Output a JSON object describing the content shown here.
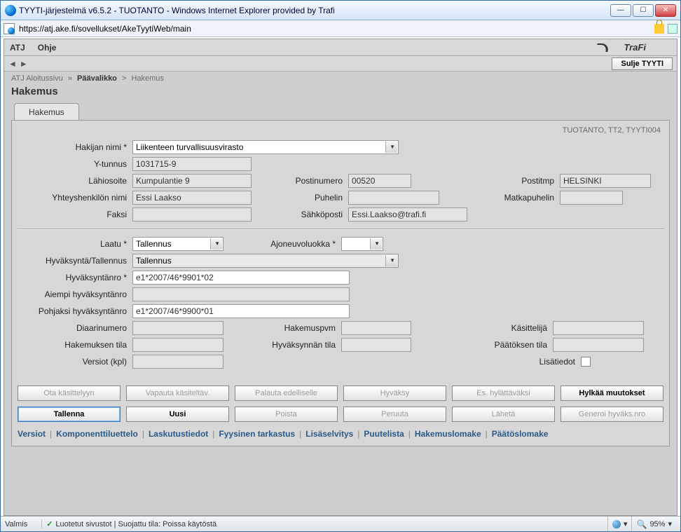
{
  "window": {
    "title": "TYYTI-järjestelmä v6.5.2 - TUOTANTO - Windows Internet Explorer provided by Trafi"
  },
  "addr": {
    "url": "https://atj.ake.fi/sovellukset/AkeTyytiWeb/main"
  },
  "menu": {
    "item1": "ATJ",
    "item2": "Ohje",
    "logo": "TraFi",
    "sulje": "Sulje TYYTI"
  },
  "breadcrumb": {
    "a": "ATJ Aloitussivu",
    "b": "Päävalikko",
    "c": "Hakemus"
  },
  "page": {
    "title": "Hakemus",
    "tab": "Hakemus",
    "env": "TUOTANTO, TT2, TYYTI004"
  },
  "labels": {
    "hakija_nimi": "Hakijan nimi *",
    "ytunnus": "Y-tunnus",
    "lahiosoite": "Lähiosoite",
    "postinumero": "Postinumero",
    "postitmp": "Postitmp",
    "yhteyshenkilo": "Yhteyshenkilön nimi",
    "puhelin": "Puhelin",
    "matkapuhelin": "Matkapuhelin",
    "faksi": "Faksi",
    "sahkoposti": "Sähköposti",
    "laatu": "Laatu *",
    "ajoneuvoluokka": "Ajoneuvoluokka *",
    "hyvtal": "Hyväksyntä/Tallennus",
    "hyvnro": "Hyväksyntänro *",
    "aiempi": "Aiempi hyväksyntänro",
    "pohjaksi": "Pohjaksi hyväksyntänro",
    "diaari": "Diaarinumero",
    "hakemuspvm": "Hakemuspvm",
    "kasittelija": "Käsittelijä",
    "hakemtila": "Hakemuksen tila",
    "hyvtila": "Hyväksynnän tila",
    "paatostila": "Päätöksen tila",
    "versiot": "Versiot (kpl)",
    "lisatiedot": "Lisätiedot"
  },
  "values": {
    "hakija_nimi": "Liikenteen turvallisuusvirasto",
    "ytunnus": "1031715-9",
    "lahiosoite": "Kumpulantie 9",
    "postinumero": "00520",
    "postitmp": "HELSINKI",
    "yhteyshenkilo": "Essi Laakso",
    "puhelin": "",
    "matkapuhelin": "",
    "faksi": "",
    "sahkoposti": "Essi.Laakso@trafi.fi",
    "laatu": "Tallennus",
    "ajoneuvoluokka": "",
    "hyvtal": "Tallennus",
    "hyvnro": "e1*2007/46*9901*02",
    "aiempi": "",
    "pohjaksi": "e1*2007/46*9900*01",
    "diaari": "",
    "hakemuspvm": "",
    "kasittelija": "",
    "hakemtila": "",
    "hyvtila": "",
    "paatostila": "",
    "versiot": ""
  },
  "buttons": {
    "ota": "Ota käsittelyyn",
    "vapauta": "Vapauta käsiteltäv.",
    "palauta": "Palauta edelliselle",
    "hyvaksy": "Hyväksy",
    "eshyl": "Es. hylättäväksi",
    "hylkaa": "Hylkää muutokset",
    "tallenna": "Tallenna",
    "uusi": "Uusi",
    "poista": "Poista",
    "peruuta": "Peruuta",
    "laheta": "Lähetä",
    "generoi": "Generoi hyväks.nro"
  },
  "links": {
    "versiot": "Versiot",
    "komp": "Komponenttiluettelo",
    "laskutus": "Laskutustiedot",
    "fyys": "Fyysinen tarkastus",
    "lisa": "Lisäselvitys",
    "puute": "Puutelista",
    "hakemuslomake": "Hakemuslomake",
    "paatos": "Päätöslomake"
  },
  "status": {
    "valmis": "Valmis",
    "trusted": "Luotetut sivustot | Suojattu tila: Poissa käytöstä",
    "zoom": "95%"
  }
}
